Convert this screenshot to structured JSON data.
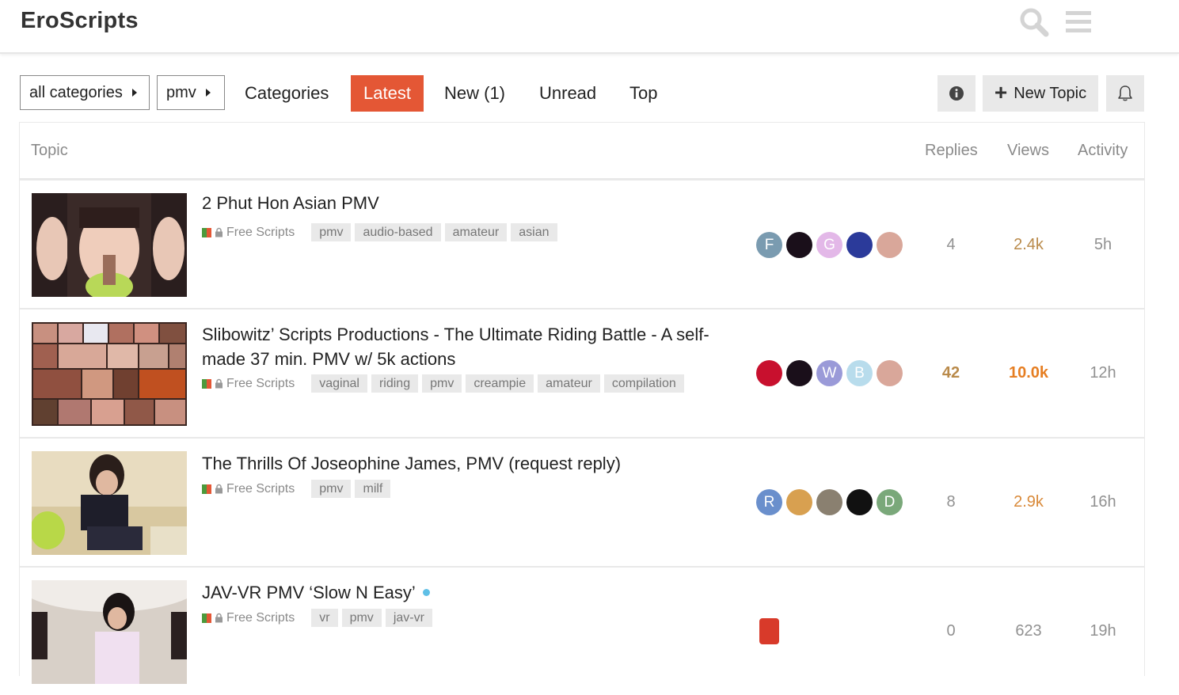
{
  "site": {
    "title": "EroScripts"
  },
  "header": {
    "icons": [
      "search-icon",
      "menu-icon"
    ]
  },
  "nav": {
    "category_dropdown": "all categories",
    "tag_dropdown": "pmv",
    "links": {
      "categories": "Categories",
      "latest": "Latest",
      "new": "New (1)",
      "unread": "Unread",
      "top": "Top"
    },
    "new_topic": "New Topic",
    "active_color": "#e45735"
  },
  "table": {
    "headers": {
      "topic": "Topic",
      "replies": "Replies",
      "views": "Views",
      "activity": "Activity"
    },
    "rows": [
      {
        "title": "2 Phut Hon Asian PMV",
        "category": "Free Scripts",
        "tags": [
          "pmv",
          "audio-based",
          "amateur",
          "asian"
        ],
        "posters": [
          {
            "letter": "F",
            "color": "#7a9bb0"
          },
          {
            "letter": "",
            "color": "#1a0f1a"
          },
          {
            "letter": "G",
            "color": "#e3b8e8"
          },
          {
            "letter": "",
            "color": "#2b3a9a"
          },
          {
            "letter": "",
            "color": "#d9a79a"
          }
        ],
        "replies": "4",
        "views": "2.4k",
        "activity": "5h",
        "replies_color": "#919191",
        "views_color": "#b98a4a"
      },
      {
        "title": "Slibowitz’ Scripts Productions - The Ultimate Riding Battle - A self-made 37 min. PMV w/ 5k actions",
        "category": "Free Scripts",
        "tags": [
          "vaginal",
          "riding",
          "pmv",
          "creampie",
          "amateur",
          "compilation"
        ],
        "posters": [
          {
            "letter": "",
            "color": "#c8102e"
          },
          {
            "letter": "",
            "color": "#1a0f1a"
          },
          {
            "letter": "W",
            "color": "#9a9ad8"
          },
          {
            "letter": "B",
            "color": "#b8dcec"
          },
          {
            "letter": "",
            "color": "#d9a79a"
          }
        ],
        "replies": "42",
        "views": "10.0k",
        "activity": "12h",
        "replies_color": "#b98a4a",
        "views_color": "#e67e22"
      },
      {
        "title": "The Thrills Of Joseophine James, PMV (request reply)",
        "category": "Free Scripts",
        "tags": [
          "pmv",
          "milf"
        ],
        "posters": [
          {
            "letter": "R",
            "color": "#6a8fcc"
          },
          {
            "letter": "",
            "color": "#d8a050"
          },
          {
            "letter": "",
            "color": "#8a8070"
          },
          {
            "letter": "",
            "color": "#111111"
          },
          {
            "letter": "D",
            "color": "#7aa87a"
          }
        ],
        "replies": "8",
        "views": "2.9k",
        "activity": "16h",
        "replies_color": "#919191",
        "views_color": "#d98a3a"
      },
      {
        "title": "JAV-VR PMV ‘Slow N Easy’",
        "category": "Free Scripts",
        "tags": [
          "vr",
          "pmv",
          "jav-vr"
        ],
        "posters": [
          {
            "letter": "",
            "color": "#d83a2a"
          }
        ],
        "replies": "0",
        "views": "623",
        "activity": "19h",
        "replies_color": "#919191",
        "views_color": "#919191",
        "unread": true
      }
    ]
  }
}
